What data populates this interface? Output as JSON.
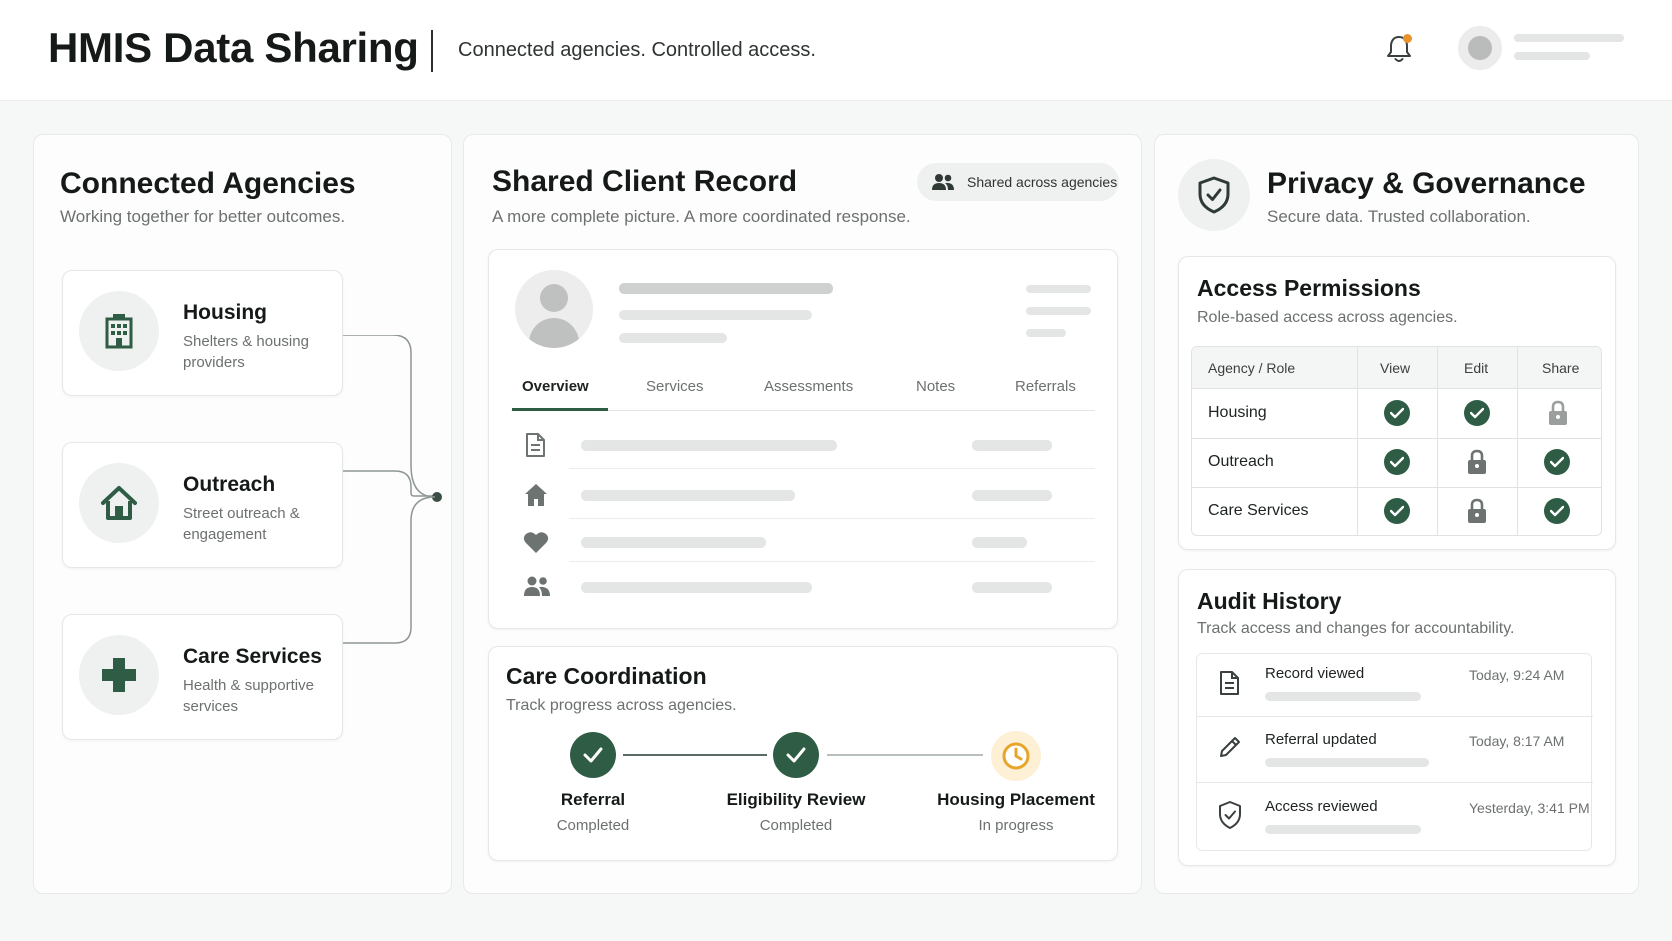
{
  "header": {
    "title": "HMIS Data Sharing",
    "subtitle": "Connected agencies. Controlled access."
  },
  "agencies": {
    "title": "Connected Agencies",
    "subtitle": "Working together for better outcomes.",
    "items": [
      {
        "name": "Housing",
        "desc": "Shelters & housing providers",
        "icon": "building-icon"
      },
      {
        "name": "Outreach",
        "desc": "Street outreach & engagement",
        "icon": "house-icon"
      },
      {
        "name": "Care Services",
        "desc": "Health & supportive services",
        "icon": "medical-cross-icon"
      }
    ]
  },
  "record": {
    "title": "Shared Client Record",
    "subtitle": "A more complete picture. A more coordinated response.",
    "badge": "Shared across agencies",
    "tabs": [
      "Overview",
      "Services",
      "Assessments",
      "Notes",
      "Referrals"
    ],
    "active_tab": "Overview"
  },
  "coordination": {
    "title": "Care Coordination",
    "subtitle": "Track progress across agencies.",
    "steps": [
      {
        "label": "Referral",
        "status": "Completed"
      },
      {
        "label": "Eligibility Review",
        "status": "Completed"
      },
      {
        "label": "Housing Placement",
        "status": "In progress"
      }
    ]
  },
  "governance": {
    "title": "Privacy & Governance",
    "subtitle": "Secure data. Trusted collaboration."
  },
  "permissions": {
    "title": "Access Permissions",
    "subtitle": "Role-based access across agencies.",
    "columns": [
      "Agency / Role",
      "View",
      "Edit",
      "Share"
    ],
    "rows": [
      {
        "role": "Housing",
        "view": "check",
        "edit": "check",
        "share": "lock"
      },
      {
        "role": "Outreach",
        "view": "check",
        "edit": "lock",
        "share": "check"
      },
      {
        "role": "Care Services",
        "view": "check",
        "edit": "lock",
        "share": "check"
      }
    ]
  },
  "audit": {
    "title": "Audit History",
    "subtitle": "Track access and changes for accountability.",
    "items": [
      {
        "title": "Record viewed",
        "time": "Today, 9:24 AM",
        "icon": "document-icon"
      },
      {
        "title": "Referral updated",
        "time": "Today, 8:17 AM",
        "icon": "pencil-icon"
      },
      {
        "title": "Access reviewed",
        "time": "Yesterday, 3:41 PM",
        "icon": "shield-check-icon"
      }
    ]
  },
  "colors": {
    "accent": "#2e5c44",
    "in_progress": "#e8a52c",
    "notification": "#e8932c"
  }
}
